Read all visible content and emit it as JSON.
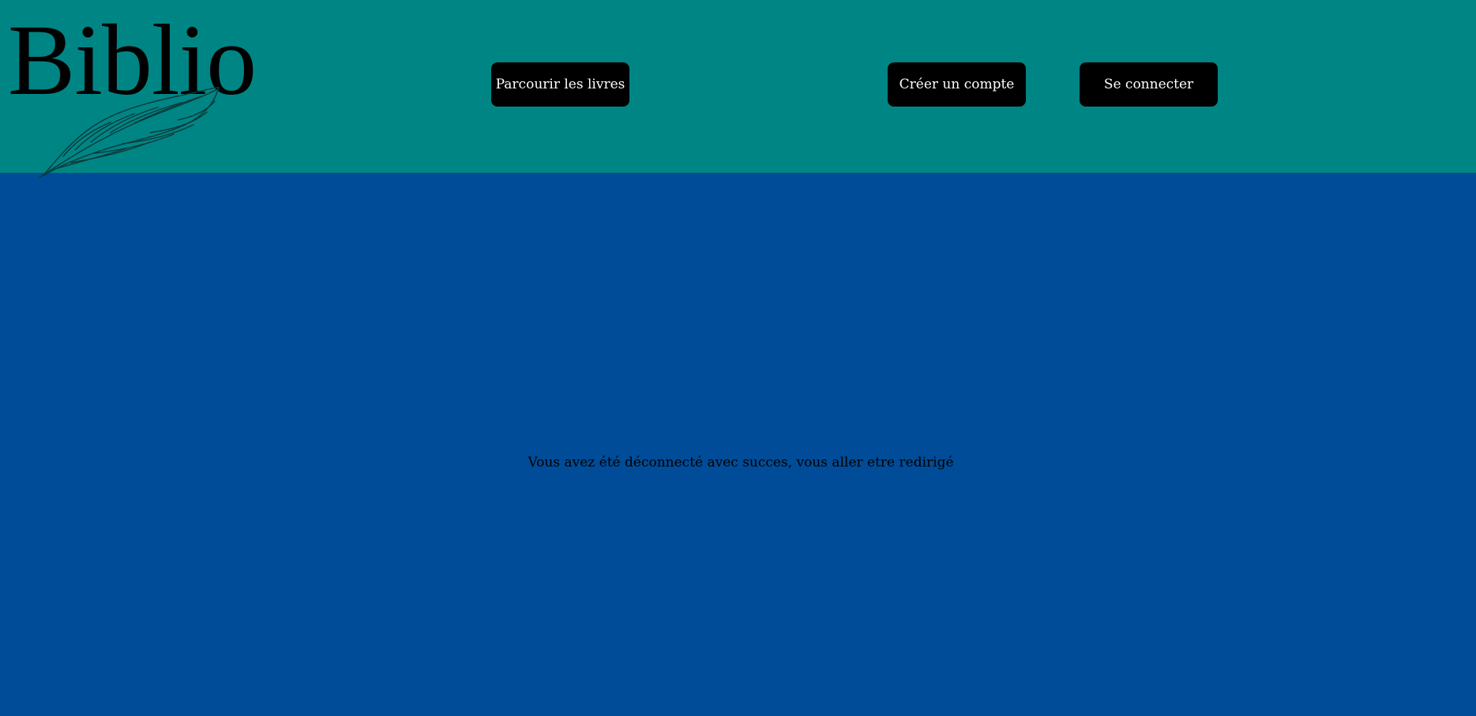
{
  "header": {
    "logo_text": "Biblio",
    "logo_icon": "feather-icon",
    "nav": {
      "browse_label": "Parcourir les livres",
      "register_label": "Créer un compte",
      "login_label": "Se connecter"
    }
  },
  "main": {
    "message": "Vous avez été déconnecté avec succes, vous aller etre redirigé"
  },
  "colors": {
    "header_bg": "#008585",
    "page_bg": "#004c98",
    "button_bg": "#000000",
    "button_text": "#ffffff"
  }
}
